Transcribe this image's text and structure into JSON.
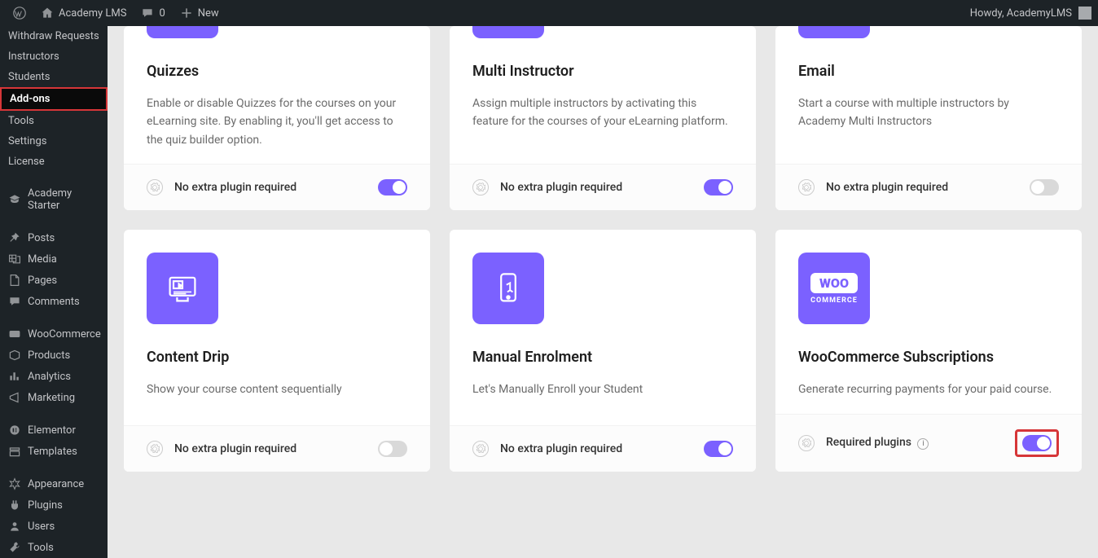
{
  "adminBar": {
    "siteName": "Academy LMS",
    "commentCount": "0",
    "newLabel": "New",
    "greeting": "Howdy, AcademyLMS"
  },
  "sidebar": {
    "sub": [
      {
        "label": "Withdraw Requests",
        "highlighted": false
      },
      {
        "label": "Instructors",
        "highlighted": false
      },
      {
        "label": "Students",
        "highlighted": false
      },
      {
        "label": "Add-ons",
        "highlighted": true
      },
      {
        "label": "Tools",
        "highlighted": false
      },
      {
        "label": "Settings",
        "highlighted": false
      },
      {
        "label": "License",
        "highlighted": false
      }
    ],
    "groups": [
      [
        {
          "label": "Academy Starter",
          "icon": "cap"
        }
      ],
      [
        {
          "label": "Posts",
          "icon": "pin"
        },
        {
          "label": "Media",
          "icon": "media"
        },
        {
          "label": "Pages",
          "icon": "page"
        },
        {
          "label": "Comments",
          "icon": "comment"
        }
      ],
      [
        {
          "label": "WooCommerce",
          "icon": "woo"
        },
        {
          "label": "Products",
          "icon": "product"
        },
        {
          "label": "Analytics",
          "icon": "analytics"
        },
        {
          "label": "Marketing",
          "icon": "marketing"
        }
      ],
      [
        {
          "label": "Elementor",
          "icon": "elementor"
        },
        {
          "label": "Templates",
          "icon": "templates"
        }
      ],
      [
        {
          "label": "Appearance",
          "icon": "appearance"
        },
        {
          "label": "Plugins",
          "icon": "plugins"
        },
        {
          "label": "Users",
          "icon": "users"
        },
        {
          "label": "Tools",
          "icon": "tools"
        }
      ]
    ]
  },
  "cards": {
    "row1": [
      {
        "title": "Quizzes",
        "desc": "Enable or disable Quizzes for the courses on your eLearning site. By enabling it, you'll get access to the quiz builder option.",
        "footerLabel": "No extra plugin required",
        "toggle": "on",
        "info": false,
        "highlightToggle": false
      },
      {
        "title": "Multi Instructor",
        "desc": "Assign multiple instructors by activating this feature for the courses of your eLearning platform.",
        "footerLabel": "No extra plugin required",
        "toggle": "on",
        "info": false,
        "highlightToggle": false
      },
      {
        "title": "Email",
        "desc": "Start a course with multiple instructors by Academy Multi Instructors",
        "footerLabel": "No extra plugin required",
        "toggle": "off",
        "info": false,
        "highlightToggle": false
      }
    ],
    "row2": [
      {
        "title": "Content Drip",
        "desc": "Show your course content sequentially",
        "footerLabel": "No extra plugin required",
        "toggle": "off",
        "info": false,
        "highlightToggle": false,
        "icon": "drip"
      },
      {
        "title": "Manual Enrolment",
        "desc": "Let's Manually Enroll your Student",
        "footerLabel": "No extra plugin required",
        "toggle": "on",
        "info": false,
        "highlightToggle": false,
        "icon": "manual"
      },
      {
        "title": "WooCommerce Subscriptions",
        "desc": "Generate recurring payments for your paid course.",
        "footerLabel": "Required plugins",
        "toggle": "on",
        "info": true,
        "highlightToggle": true,
        "icon": "woo"
      }
    ]
  }
}
